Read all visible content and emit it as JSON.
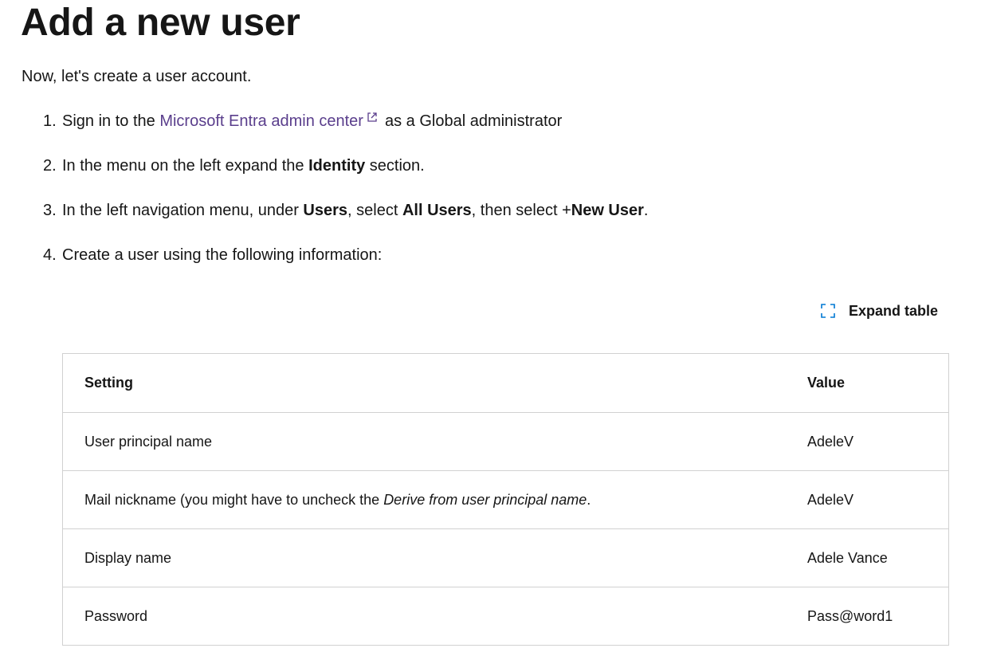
{
  "page": {
    "title": "Add a new user",
    "intro": "Now, let's create a user account."
  },
  "steps": [
    {
      "number": "1.",
      "text_before": "Sign in to the ",
      "link_text": "Microsoft Entra admin center",
      "link_icon": "external-link-icon",
      "text_after": "as a Global administrator"
    },
    {
      "number": "2.",
      "text_before": "In the menu on the left expand the ",
      "bold": "Identity",
      "text_after": " section."
    },
    {
      "number": "3.",
      "text_1": "In the left navigation menu, under ",
      "bold_1": "Users",
      "text_2": ", select ",
      "bold_2": "All Users",
      "text_3": ", then select +",
      "bold_3": "New User",
      "text_4": "."
    },
    {
      "number": "4.",
      "text": "Create a user using the following information:"
    }
  ],
  "expand_table": {
    "label": "Expand table",
    "icon": "expand-icon"
  },
  "table": {
    "headers": [
      "Setting",
      "Value"
    ],
    "rows": [
      {
        "setting": "User principal name",
        "value": "AdeleV"
      },
      {
        "setting_before": "Mail nickname (you might have to uncheck the ",
        "setting_italic": "Derive from user principal name",
        "setting_after": ".",
        "value": "AdeleV"
      },
      {
        "setting": "Display name",
        "value": "Adele Vance"
      },
      {
        "setting": "Password",
        "value": "Pass@word1"
      }
    ]
  },
  "colors": {
    "link": "#5a3e8c",
    "text": "#161616",
    "border": "#d1d1d1",
    "expand_icon": "#0078d4"
  }
}
